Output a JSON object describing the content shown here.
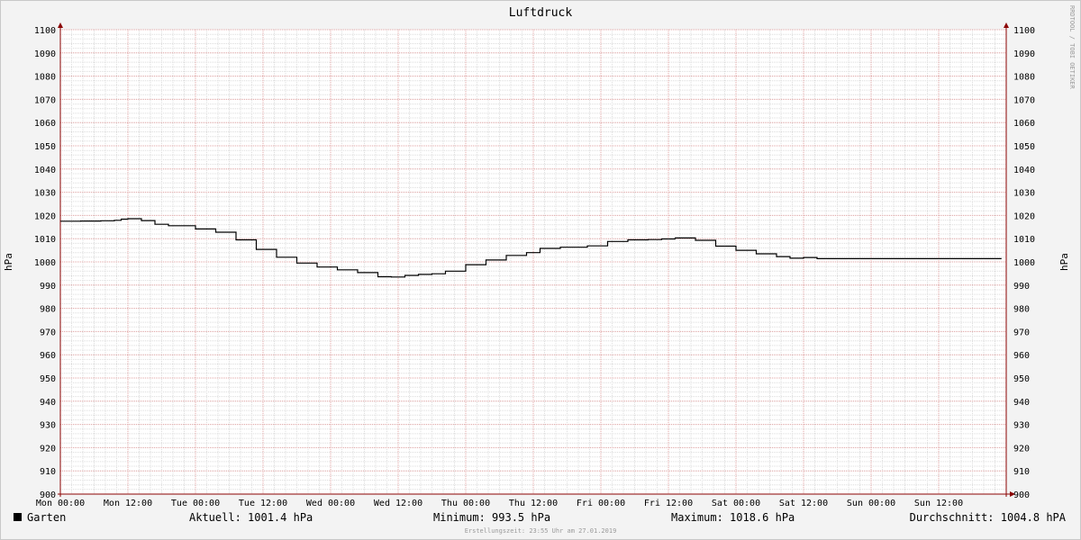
{
  "chart_data": {
    "type": "line",
    "title": "Luftdruck",
    "ylabel_left": "hPa",
    "ylabel_right": "hPa",
    "ylim": [
      900,
      1100
    ],
    "ytick_step": 10,
    "xlim": [
      0,
      14
    ],
    "x_unit": "half-day index (Mon 00:00 = 0)",
    "xtick_labels": [
      "Mon 00:00",
      "Mon 12:00",
      "Tue 00:00",
      "Tue 12:00",
      "Wed 00:00",
      "Wed 12:00",
      "Thu 00:00",
      "Thu 12:00",
      "Fri 00:00",
      "Fri 12:00",
      "Sat 00:00",
      "Sat 12:00",
      "Sun 00:00",
      "Sun 12:00"
    ],
    "grid": true,
    "series": [
      {
        "name": "Garten",
        "color": "#000000",
        "x": [
          0,
          0.3,
          0.6,
          0.8,
          0.9,
          1.0,
          1.2,
          1.4,
          1.6,
          2.0,
          2.3,
          2.6,
          2.9,
          3.2,
          3.5,
          3.8,
          4.1,
          4.4,
          4.7,
          4.9,
          5.1,
          5.3,
          5.5,
          5.7,
          6.0,
          6.3,
          6.6,
          6.9,
          7.1,
          7.4,
          7.8,
          8.1,
          8.4,
          8.7,
          8.9,
          9.1,
          9.4,
          9.7,
          10.0,
          10.3,
          10.6,
          10.8,
          11.0,
          11.2,
          11.5,
          12.0,
          12.5,
          13.0,
          13.5,
          13.93
        ],
        "y": [
          1017.5,
          1017.6,
          1017.7,
          1017.9,
          1018.4,
          1018.6,
          1017.8,
          1016.2,
          1015.6,
          1014.2,
          1012.8,
          1009.5,
          1005.4,
          1002.0,
          999.5,
          997.8,
          996.6,
          995.4,
          993.6,
          993.5,
          994.2,
          994.6,
          994.9,
          996.0,
          998.8,
          1000.8,
          1002.8,
          1004.0,
          1005.8,
          1006.3,
          1006.9,
          1008.8,
          1009.5,
          1009.6,
          1009.9,
          1010.3,
          1009.3,
          1006.8,
          1005.0,
          1003.5,
          1002.3,
          1001.6,
          1001.9,
          1001.4,
          1001.4,
          1001.4,
          1001.4,
          1001.4,
          1001.4,
          1001.4
        ]
      }
    ]
  },
  "credits": {
    "watermark": "RRDTOOL / TOBI OETIKER",
    "created": "Erstellungszeit: 23:55 Uhr am 27.01.2019"
  },
  "legend": {
    "swatch_color": "#000000",
    "series_label": "Garten",
    "current": "Aktuell: 1001.4 hPa",
    "minimum": "Minimum: 993.5 hPa",
    "maximum": "Maximum: 1018.6 hPa",
    "average": "Durchschnitt: 1004.8 hPA"
  },
  "colors": {
    "background": "#f3f3f3",
    "plot_background": "#ffffff",
    "major_grid": "#e0a0a0",
    "minor_grid": "#dcdcdc",
    "axis": "#8b0000"
  }
}
